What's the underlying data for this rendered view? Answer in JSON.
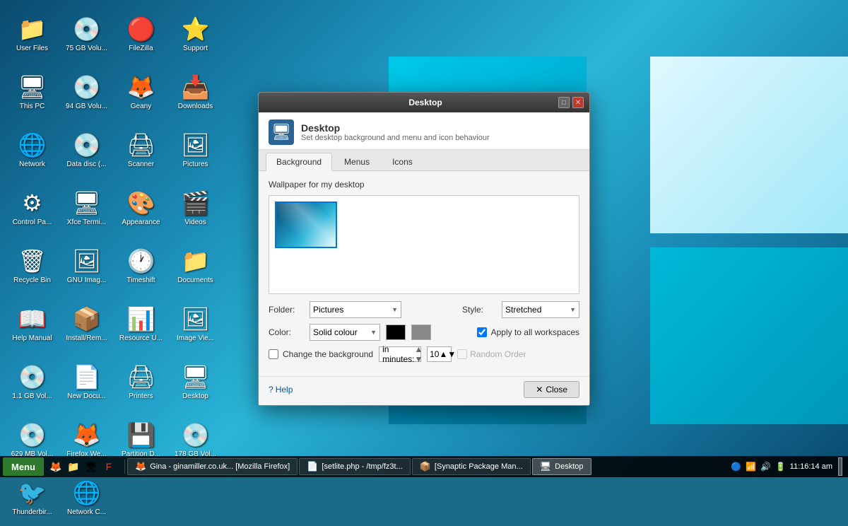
{
  "desktop": {
    "icons": [
      {
        "id": "user-files",
        "label": "User Files",
        "emoji": "📁",
        "color": "#4fc3f7"
      },
      {
        "id": "75gb-vol",
        "label": "75 GB Volu...",
        "emoji": "💿",
        "color": "#90a4ae"
      },
      {
        "id": "filezilla",
        "label": "FileZilla",
        "emoji": "🔴",
        "color": "#e53935"
      },
      {
        "id": "support",
        "label": "Support",
        "emoji": "⭐",
        "color": "#ffd54f"
      },
      {
        "id": "this-pc",
        "label": "This PC",
        "emoji": "🖥",
        "color": "#78909c"
      },
      {
        "id": "94gb-vol",
        "label": "94 GB Volu...",
        "emoji": "💿",
        "color": "#607d8b"
      },
      {
        "id": "geany",
        "label": "Geany",
        "emoji": "🦊",
        "color": "#e67c00"
      },
      {
        "id": "downloads",
        "label": "Downloads",
        "emoji": "📥",
        "color": "#42a5f5"
      },
      {
        "id": "network",
        "label": "Network",
        "emoji": "🌐",
        "color": "#7e57c2"
      },
      {
        "id": "data-disc",
        "label": "Data disc (...",
        "emoji": "💿",
        "color": "#546e7a"
      },
      {
        "id": "scanner",
        "label": "Scanner",
        "emoji": "🖨",
        "color": "#78909c"
      },
      {
        "id": "pictures",
        "label": "Pictures",
        "emoji": "🖼",
        "color": "#42a5f5"
      },
      {
        "id": "control-panel",
        "label": "Control Pa...",
        "emoji": "⚙",
        "color": "#29b6f6"
      },
      {
        "id": "xfce-terminal",
        "label": "Xfce Termi...",
        "emoji": "🖥",
        "color": "#37474f"
      },
      {
        "id": "appearance",
        "label": "Appearance",
        "emoji": "🎨",
        "color": "#e91e63"
      },
      {
        "id": "videos",
        "label": "Videos",
        "emoji": "🎬",
        "color": "#7986cb"
      },
      {
        "id": "recycle-bin",
        "label": "Recycle Bin",
        "emoji": "🗑",
        "color": "#78909c"
      },
      {
        "id": "gnu-image",
        "label": "GNU Imag...",
        "emoji": "🖼",
        "color": "#78909c"
      },
      {
        "id": "timeshift",
        "label": "Timeshift",
        "emoji": "🕐",
        "color": "#e53935"
      },
      {
        "id": "documents",
        "label": "Documents",
        "emoji": "📁",
        "color": "#42a5f5"
      },
      {
        "id": "help-manual",
        "label": "Help Manual",
        "emoji": "📖",
        "color": "#ffa726"
      },
      {
        "id": "install-remove",
        "label": "Install/Rem...",
        "emoji": "📦",
        "color": "#26a69a"
      },
      {
        "id": "resource-u",
        "label": "Resource U...",
        "emoji": "📊",
        "color": "#66bb6a"
      },
      {
        "id": "image-viewer",
        "label": "Image Vie...",
        "emoji": "🖼",
        "color": "#7e57c2"
      },
      {
        "id": "1gb-vol",
        "label": "1.1 GB Vol...",
        "emoji": "💿",
        "color": "#78909c"
      },
      {
        "id": "new-document",
        "label": "New Docu...",
        "emoji": "📄",
        "color": "#78909c"
      },
      {
        "id": "printers",
        "label": "Printers",
        "emoji": "🖨",
        "color": "#78909c"
      },
      {
        "id": "desktop",
        "label": "Desktop",
        "emoji": "🖥",
        "color": "#42a5f5"
      },
      {
        "id": "629mb-vol",
        "label": "629 MB Vol...",
        "emoji": "💿",
        "color": "#78909c"
      },
      {
        "id": "firefox",
        "label": "Firefox We...",
        "emoji": "🦊",
        "color": "#e65100"
      },
      {
        "id": "partition-d",
        "label": "Partition D...",
        "emoji": "💾",
        "color": "#78909c"
      },
      {
        "id": "178gb-vol",
        "label": "178 GB Vol...",
        "emoji": "💿",
        "color": "#78909c"
      },
      {
        "id": "thunderbird",
        "label": "Thunderbir...",
        "emoji": "🐦",
        "color": "#0277bd"
      },
      {
        "id": "network-c",
        "label": "Network C...",
        "emoji": "🌐",
        "color": "#78909c"
      }
    ]
  },
  "dialog": {
    "title": "Desktop",
    "header_title": "Desktop",
    "header_subtitle": "Set desktop background and menu and icon behaviour",
    "tabs": [
      "Background",
      "Menus",
      "Icons"
    ],
    "active_tab": "Background",
    "wallpaper_label": "Wallpaper for my desktop",
    "folder_label": "Folder:",
    "folder_value": "Pictures",
    "style_label": "Style:",
    "style_value": "Stretched",
    "color_label": "Color:",
    "color_value": "Solid colour",
    "change_bg_label": "Change the background",
    "in_minutes_value": "in minutes:",
    "minutes_num": "10",
    "random_order_label": "Random Order",
    "apply_workspaces_label": "Apply to all workspaces",
    "help_text": "Help",
    "close_text": "Close"
  },
  "taskbar": {
    "start_label": "Menu",
    "apps": [
      {
        "id": "gina-firefox",
        "label": "Gina - ginamiller.co.uk... [Mozilla Firefox]",
        "icon": "🦊"
      },
      {
        "id": "setlite-php",
        "label": "[setlite.php - /tmp/fz3t...",
        "icon": "📄"
      },
      {
        "id": "synaptic",
        "label": "[Synaptic Package Man...",
        "icon": "📦"
      },
      {
        "id": "desktop-app",
        "label": "Desktop",
        "icon": "🖥"
      }
    ],
    "clock": "11:16:14 am"
  }
}
